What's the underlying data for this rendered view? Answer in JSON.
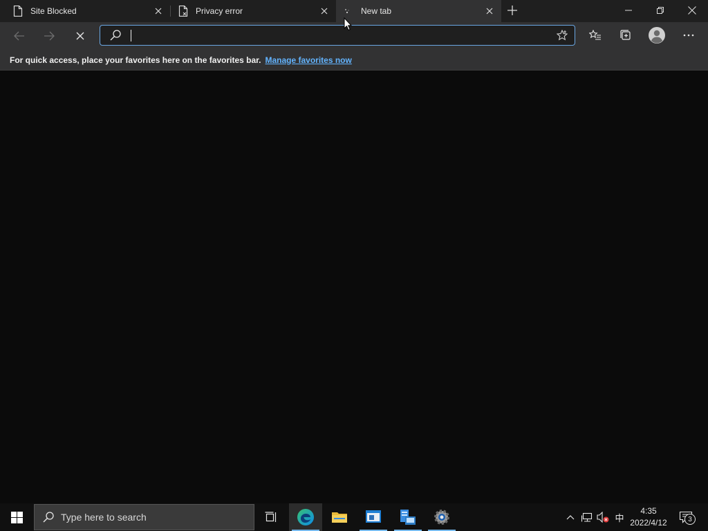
{
  "tabs": [
    {
      "title": "Site Blocked",
      "icon": "page-icon",
      "close_icon": "close-icon",
      "active": false
    },
    {
      "title": "Privacy error",
      "icon": "page-error-icon",
      "close_icon": "close-icon",
      "active": false
    },
    {
      "title": "New tab",
      "icon": "loading-spinner-icon",
      "close_icon": "close-icon",
      "active": true
    }
  ],
  "window_controls": {
    "new_tab_icon": "plus-icon",
    "minimize_icon": "minimize-icon",
    "restore_icon": "restore-icon",
    "close_icon": "close-icon"
  },
  "toolbar": {
    "back_icon": "back-arrow-icon",
    "forward_icon": "forward-arrow-icon",
    "stop_icon": "stop-x-icon",
    "address_value": "",
    "address_search_icon": "search-icon",
    "add_favorite_icon": "star-icon",
    "favorites_icon": "favorites-list-icon",
    "collections_icon": "collections-icon",
    "profile_icon": "profile-avatar-icon",
    "menu_icon": "more-dots-icon"
  },
  "favorites_bar": {
    "message": "For quick access, place your favorites here on the favorites bar.",
    "link": "Manage favorites now"
  },
  "taskbar": {
    "start_icon": "windows-logo-icon",
    "search_placeholder": "Type here to search",
    "search_icon": "search-icon",
    "apps": [
      {
        "name": "task-view",
        "icon": "task-view-icon"
      },
      {
        "name": "edge",
        "icon": "edge-icon",
        "active": true
      },
      {
        "name": "file-explorer",
        "icon": "folder-icon"
      },
      {
        "name": "app-window",
        "icon": "app-window-icon"
      },
      {
        "name": "server-manager",
        "icon": "server-manager-icon"
      },
      {
        "name": "settings",
        "icon": "gear-icon"
      }
    ],
    "tray": {
      "chevron_icon": "chevron-up-icon",
      "network_icon": "network-icon",
      "volume_icon": "volume-muted-icon",
      "ime": "中",
      "time": "4:35",
      "date": "2022/4/12",
      "notifications_icon": "notification-icon",
      "notifications_count": "3"
    }
  },
  "colors": {
    "accent_blue": "#63b4ff",
    "address_border": "#6aa7e4",
    "edge_blue": "#0c8be8",
    "edge_green": "#38c172"
  }
}
